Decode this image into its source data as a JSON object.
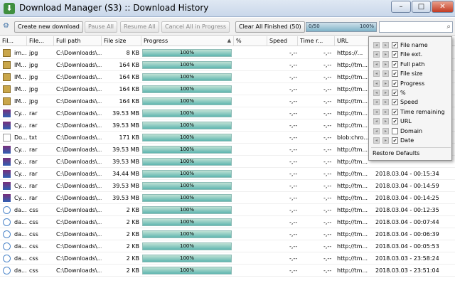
{
  "window": {
    "title": "Download Manager (S3) :: Download History",
    "minimize_glyph": "–",
    "maximize_glyph": "□",
    "close_glyph": "✕"
  },
  "toolbar": {
    "create_label": "Create new download",
    "pause_label": "Pause All",
    "resume_label": "Resume All",
    "cancel_label": "Cancel All in Progress",
    "clear_label": "Clear All Finished (50)",
    "total_left": "0/50",
    "total_right": "100%",
    "search_placeholder": ""
  },
  "columns": {
    "file_name": "Fil...",
    "file_ext": "File...",
    "full_path": "Full path",
    "file_size": "File size",
    "progress": "Progress",
    "percent": "%",
    "speed": "Speed",
    "time_remaining": "Time r...",
    "url": "URL"
  },
  "rows": [
    {
      "icon": "img",
      "name": "im...",
      "ext": "jpg",
      "path": "C:\\Downloads\\...",
      "size": "8 KB",
      "progress": "100%",
      "pct": "",
      "speed": "-,--",
      "time": "-,--",
      "url": "https://...",
      "date": ""
    },
    {
      "icon": "img",
      "name": "IM...",
      "ext": "jpg",
      "path": "C:\\Downloads\\...",
      "size": "164 KB",
      "progress": "100%",
      "pct": "",
      "speed": "-,--",
      "time": "-,--",
      "url": "http://tm...",
      "date": ""
    },
    {
      "icon": "img",
      "name": "IM...",
      "ext": "jpg",
      "path": "C:\\Downloads\\...",
      "size": "164 KB",
      "progress": "100%",
      "pct": "",
      "speed": "-,--",
      "time": "-,--",
      "url": "http://tm...",
      "date": ""
    },
    {
      "icon": "img",
      "name": "IM...",
      "ext": "jpg",
      "path": "C:\\Downloads\\...",
      "size": "164 KB",
      "progress": "100%",
      "pct": "",
      "speed": "-,--",
      "time": "-,--",
      "url": "http://tm...",
      "date": ""
    },
    {
      "icon": "img",
      "name": "IM...",
      "ext": "jpg",
      "path": "C:\\Downloads\\...",
      "size": "164 KB",
      "progress": "100%",
      "pct": "",
      "speed": "-,--",
      "time": "-,--",
      "url": "http://tm...",
      "date": ""
    },
    {
      "icon": "rar",
      "name": "Cy...",
      "ext": "rar",
      "path": "C:\\Downloads\\...",
      "size": "39.53 MB",
      "progress": "100%",
      "pct": "",
      "speed": "-,--",
      "time": "-,--",
      "url": "http://tm...",
      "date": ""
    },
    {
      "icon": "rar",
      "name": "Cy...",
      "ext": "rar",
      "path": "C:\\Downloads\\...",
      "size": "39.53 MB",
      "progress": "100%",
      "pct": "",
      "speed": "-,--",
      "time": "-,--",
      "url": "http://tm...",
      "date": ""
    },
    {
      "icon": "txt",
      "name": "Do...",
      "ext": "txt",
      "path": "C:\\Downloads\\...",
      "size": "171 KB",
      "progress": "100%",
      "pct": "",
      "speed": "-,--",
      "time": "-,--",
      "url": "blob:chro...",
      "date": ""
    },
    {
      "icon": "rar",
      "name": "Cy...",
      "ext": "rar",
      "path": "C:\\Downloads\\...",
      "size": "39.53 MB",
      "progress": "100%",
      "pct": "",
      "speed": "-,--",
      "time": "-,--",
      "url": "http://tm...",
      "date": ""
    },
    {
      "icon": "rar",
      "name": "Cy...",
      "ext": "rar",
      "path": "C:\\Downloads\\...",
      "size": "39.53 MB",
      "progress": "100%",
      "pct": "",
      "speed": "-,--",
      "time": "-,--",
      "url": "http://tm...",
      "date": ""
    },
    {
      "icon": "rar",
      "name": "Cy...",
      "ext": "rar",
      "path": "C:\\Downloads\\...",
      "size": "34.44 MB",
      "progress": "100%",
      "pct": "",
      "speed": "-,--",
      "time": "-,--",
      "url": "http://tm...",
      "date": "2018.03.04 - 00:15:34"
    },
    {
      "icon": "rar",
      "name": "Cy...",
      "ext": "rar",
      "path": "C:\\Downloads\\...",
      "size": "39.53 MB",
      "progress": "100%",
      "pct": "",
      "speed": "-,--",
      "time": "-,--",
      "url": "http://tm...",
      "date": "2018.03.04 - 00:14:59"
    },
    {
      "icon": "rar",
      "name": "Cy...",
      "ext": "rar",
      "path": "C:\\Downloads\\...",
      "size": "39.53 MB",
      "progress": "100%",
      "pct": "",
      "speed": "-,--",
      "time": "-,--",
      "url": "http://tm...",
      "date": "2018.03.04 - 00:14:25"
    },
    {
      "icon": "css",
      "name": "da...",
      "ext": "css",
      "path": "C:\\Downloads\\...",
      "size": "2 KB",
      "progress": "100%",
      "pct": "",
      "speed": "-,--",
      "time": "-,--",
      "url": "http://tm...",
      "date": "2018.03.04 - 00:12:35"
    },
    {
      "icon": "css",
      "name": "da...",
      "ext": "css",
      "path": "C:\\Downloads\\...",
      "size": "2 KB",
      "progress": "100%",
      "pct": "",
      "speed": "-,--",
      "time": "-,--",
      "url": "http://tm...",
      "date": "2018.03.04 - 00:07:44"
    },
    {
      "icon": "css",
      "name": "da...",
      "ext": "css",
      "path": "C:\\Downloads\\...",
      "size": "2 KB",
      "progress": "100%",
      "pct": "",
      "speed": "-,--",
      "time": "-,--",
      "url": "http://tm...",
      "date": "2018.03.04 - 00:06:39"
    },
    {
      "icon": "css",
      "name": "da...",
      "ext": "css",
      "path": "C:\\Downloads\\...",
      "size": "2 KB",
      "progress": "100%",
      "pct": "",
      "speed": "-,--",
      "time": "-,--",
      "url": "http://tm...",
      "date": "2018.03.04 - 00:05:53"
    },
    {
      "icon": "css",
      "name": "da...",
      "ext": "css",
      "path": "C:\\Downloads\\...",
      "size": "2 KB",
      "progress": "100%",
      "pct": "",
      "speed": "-,--",
      "time": "-,--",
      "url": "http://tm...",
      "date": "2018.03.03 - 23:58:24"
    },
    {
      "icon": "css",
      "name": "da...",
      "ext": "css",
      "path": "C:\\Downloads\\...",
      "size": "2 KB",
      "progress": "100%",
      "pct": "",
      "speed": "-,--",
      "time": "-,--",
      "url": "http://tm...",
      "date": "2018.03.03 - 23:51:04"
    }
  ],
  "column_menu": {
    "items": [
      {
        "label": "File name",
        "checked": true
      },
      {
        "label": "File ext.",
        "checked": true
      },
      {
        "label": "Full path",
        "checked": true
      },
      {
        "label": "File size",
        "checked": true
      },
      {
        "label": "Progress",
        "checked": true
      },
      {
        "label": "%",
        "checked": true
      },
      {
        "label": "Speed",
        "checked": true
      },
      {
        "label": "Time remaining",
        "checked": true
      },
      {
        "label": "URL",
        "checked": true
      },
      {
        "label": "Domain",
        "checked": false
      },
      {
        "label": "Date",
        "checked": true
      }
    ],
    "restore_label": "Restore Defaults"
  },
  "colors": {
    "progress_fill": "#5fb6b0",
    "selection": "#d8e4f3",
    "title_gradient": "#c9d7ea"
  }
}
